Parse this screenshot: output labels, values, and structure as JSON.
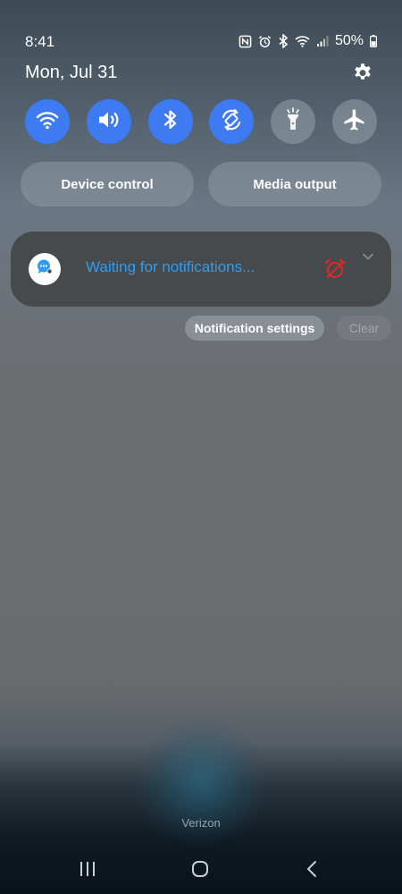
{
  "status_bar": {
    "time": "8:41",
    "icons": [
      "nfc-icon",
      "alarm-icon",
      "bluetooth-icon",
      "wifi-icon",
      "signal-icon"
    ],
    "battery_percent": "50%"
  },
  "header": {
    "date": "Mon, Jul 31"
  },
  "quick_settings": {
    "tiles": [
      {
        "icon": "wifi-icon",
        "state": "on"
      },
      {
        "icon": "sound-icon",
        "state": "on"
      },
      {
        "icon": "bluetooth-icon",
        "state": "on"
      },
      {
        "icon": "auto-rotate-icon",
        "state": "on"
      },
      {
        "icon": "flashlight-icon",
        "state": "off"
      },
      {
        "icon": "airplane-icon",
        "state": "off"
      }
    ],
    "device_control_label": "Device control",
    "media_output_label": "Media output"
  },
  "notification": {
    "text": "Waiting for notifications...",
    "app_icon": "chat-bubble-icon",
    "status_icon": "alarm-off-icon"
  },
  "actions": {
    "notification_settings_label": "Notification settings",
    "clear_label": "Clear"
  },
  "carrier": "Verizon",
  "colors": {
    "accent": "#3e7bf2",
    "notification_text": "#2f9cf0",
    "alarm_icon": "#d62b2b"
  }
}
